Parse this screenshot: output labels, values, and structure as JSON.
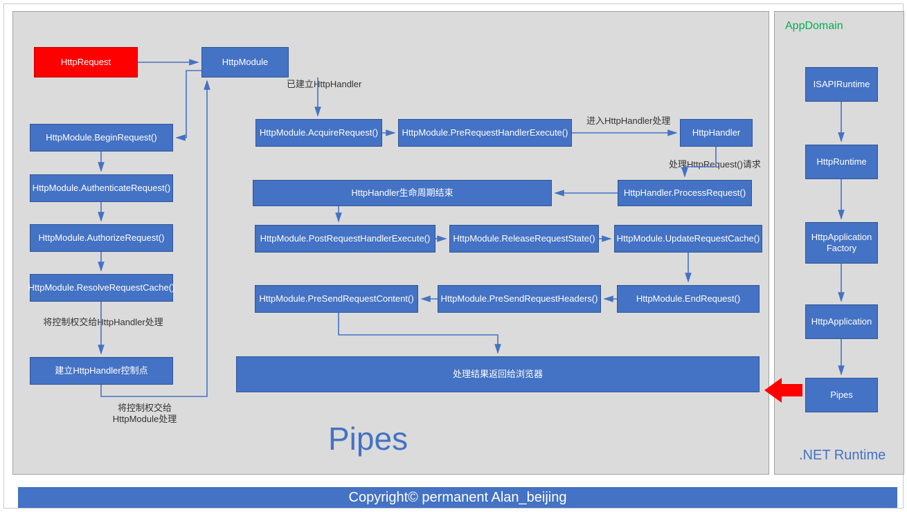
{
  "left": {
    "httpRequest": "HttpRequest",
    "httpModule": "HttpModule",
    "beginRequest": "HttpModule.BeginRequest()",
    "authenticateRequest": "HttpModule.AuthenticateRequest()",
    "authorizeRequest": "HttpModule.AuthorizeRequest()",
    "resolveRequestCache": "HttpModule.ResolveRequestCache()",
    "createHandler": "建立HttpHandler控制点",
    "acquireRequest": "HttpModule.AcquireRequest()",
    "preRequestHandlerExecute": "HttpModule.PreRequestHandlerExecute()",
    "httpHandler": "HttpHandler",
    "processRequest": "HttpHandler.ProcessRequest()",
    "handlerLifecycleEnd": "HttpHandler生命周期结束",
    "postRequestHandlerExecute": "HttpModule.PostRequestHandlerExecute()",
    "releaseRequestState": "HttpModule.ReleaseRequestState()",
    "updateRequestCache": "HttpModule.UpdateRequestCache()",
    "endRequest": "HttpModule.EndRequest()",
    "preSendRequestHeaders": "HttpModule.PreSendRequestHeaders()",
    "preSendRequestContent": "HttpModule.PreSendRequestContent()",
    "returnToBrowser": "处理结果返回给浏览器",
    "pipesTitle": "Pipes",
    "labels": {
      "toHttpHandler": "将控制权交给HttpHandler处理",
      "toHttpModule1": "将控制权交给",
      "toHttpModule2": "HttpModule处理",
      "handlerEstablished": "已建立HttpHandler",
      "enterHttpHandler": "进入HttpHandler处理",
      "processHttpRequest": "处理HttpRequest()请求"
    }
  },
  "right": {
    "appDomain": "AppDomain",
    "isapiRuntime": "ISAPIRuntime",
    "httpRuntime": "HttpRuntime",
    "httpAppFactory1": "HttpApplication",
    "httpAppFactory2": "Factory",
    "httpApplication": "HttpApplication",
    "pipes": "Pipes",
    "netRuntime": ".NET Runtime"
  },
  "footer": "Copyright© permanent  Alan_beijing"
}
